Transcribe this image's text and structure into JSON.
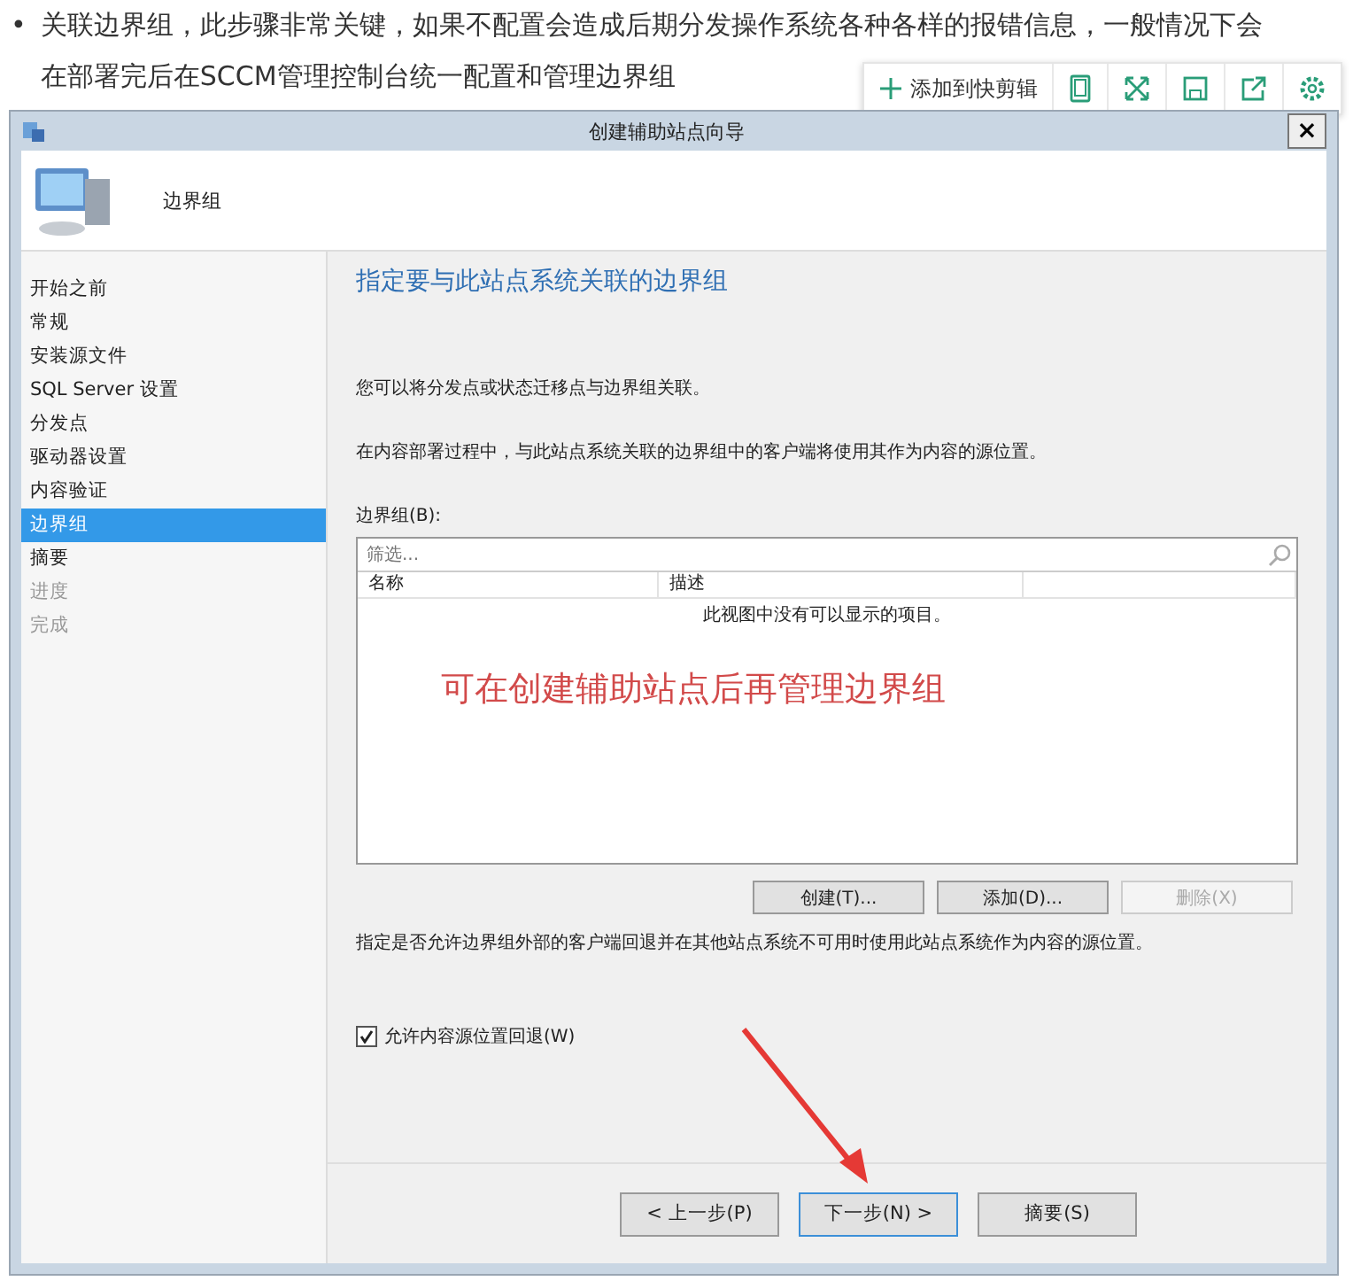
{
  "article": {
    "bullet": "•",
    "lines": [
      "关联边界组，此步骤非常关键，如果不配置会造成后期分发操作系统各种各样的报错信息，一般情况下会",
      "在部署完后在SCCM管理控制台统一配置和管理边界组"
    ]
  },
  "toolbar": {
    "add_label": "添加到快剪辑"
  },
  "window": {
    "title": "创建辅助站点向导",
    "close": "×"
  },
  "header": {
    "title": "边界组"
  },
  "sidebar": {
    "items": [
      {
        "label": "开始之前",
        "selected": false,
        "disabled": false
      },
      {
        "label": "常规",
        "selected": false,
        "disabled": false
      },
      {
        "label": "安装源文件",
        "selected": false,
        "disabled": false
      },
      {
        "label": "SQL Server 设置",
        "selected": false,
        "disabled": false
      },
      {
        "label": "分发点",
        "selected": false,
        "disabled": false
      },
      {
        "label": "驱动器设置",
        "selected": false,
        "disabled": false
      },
      {
        "label": "内容验证",
        "selected": false,
        "disabled": false
      },
      {
        "label": "边界组",
        "selected": true,
        "disabled": false
      },
      {
        "label": "摘要",
        "selected": false,
        "disabled": false
      },
      {
        "label": "进度",
        "selected": false,
        "disabled": true
      },
      {
        "label": "完成",
        "selected": false,
        "disabled": true
      }
    ]
  },
  "content": {
    "heading": "指定要与此站点系统关联的边界组",
    "intro": "您可以将分发点或状态迁移点与边界组关联。",
    "description": "在内容部署过程中，与此站点系统关联的边界组中的客户端将使用其作为内容的源位置。",
    "list_label": "边界组(B):",
    "filter": {
      "placeholder": "筛选..."
    },
    "columns": [
      "名称",
      "描述"
    ],
    "empty_message": "此视图中没有可以显示的项目。",
    "annotation": "可在创建辅助站点后再管理边界组",
    "list_buttons": [
      {
        "label": "创建(T)...",
        "disabled": false
      },
      {
        "label": "添加(D)...",
        "disabled": false
      },
      {
        "label": "删除(X)",
        "disabled": true
      }
    ],
    "fallback_note": "指定是否允许边界组外部的客户端回退并在其他站点系统不可用时使用此站点系统作为内容的源位置。",
    "fallback_checkbox": {
      "label": "允许内容源位置回退(W)",
      "checked": true
    }
  },
  "footer": {
    "buttons": [
      {
        "label": "< 上一步(P)",
        "default": false
      },
      {
        "label": "下一步(N) >",
        "default": true
      },
      {
        "label": "摘要(S)",
        "default": false
      }
    ]
  }
}
